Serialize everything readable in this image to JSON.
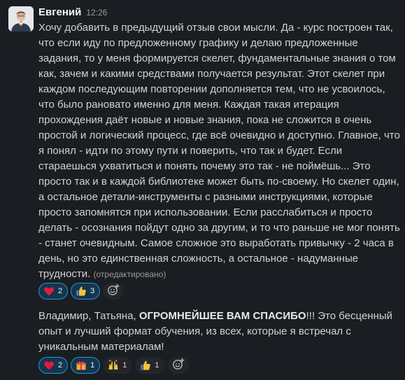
{
  "message1": {
    "author": "Евгений",
    "time": "12:26",
    "text": "Хочу добавить в предыдущий отзыв свои мысли. Да - курс построен так, что если иду по предложенному графику и делаю предложенные задания, то у меня формируется скелет, фундаментальные знания о том как, зачем и какими средствами получается результат. Этот скелет при каждом последующим повторении дополняется тем, что не усвоилось, что было рановато именно для меня. Каждая такая итерация прохождения даёт новые и новые знания, пока не сложится в очень простой и логический процесс, где всё очевидно и доступно. Главное, что я понял - идти по этому пути и поверить, что так и будет. Если стараешься ухватиться и понять почему это так - не поймёшь... Это просто так и в каждой библиотеке может быть по-своему. Но скелет один, а остальное детали-инструменты с разными инструкциями, которые просто запомнятся при использовании. Если расслабиться и просто делать - осознания пойдут одно за другим, и то что раньше не мог понять - станет очевидным. Самое сложное это выработать привычку - 2 часа в день, но это единственная сложность, а остальное - надуманные трудности.",
    "edited": "(отредактировано)",
    "reactions": [
      {
        "emoji": "heart-icon",
        "count": "2"
      },
      {
        "emoji": "thumbs-up-icon",
        "count": "3"
      }
    ]
  },
  "message2": {
    "text_before": "Владимир, Татьяна, ",
    "text_bold": "ОГРОМНЕЙШЕЕ ВАМ СПАСИБО",
    "text_after": "!!! Это бесценный опыт и лучший формат обучения, из всех, которые я встречал с уникальным материалам!",
    "reactions": [
      {
        "emoji": "heart-icon",
        "count": "2"
      },
      {
        "emoji": "gift-icon",
        "count": "1"
      },
      {
        "emoji": "raised-hands-icon",
        "count": "1"
      },
      {
        "emoji": "thumbs-up-icon",
        "count": "1"
      }
    ]
  },
  "colors": {
    "background": "#1a1d21",
    "text": "#d1d2d3",
    "reaction_active_bg": "#14354f",
    "reaction_active_border": "#1d9bd1"
  }
}
